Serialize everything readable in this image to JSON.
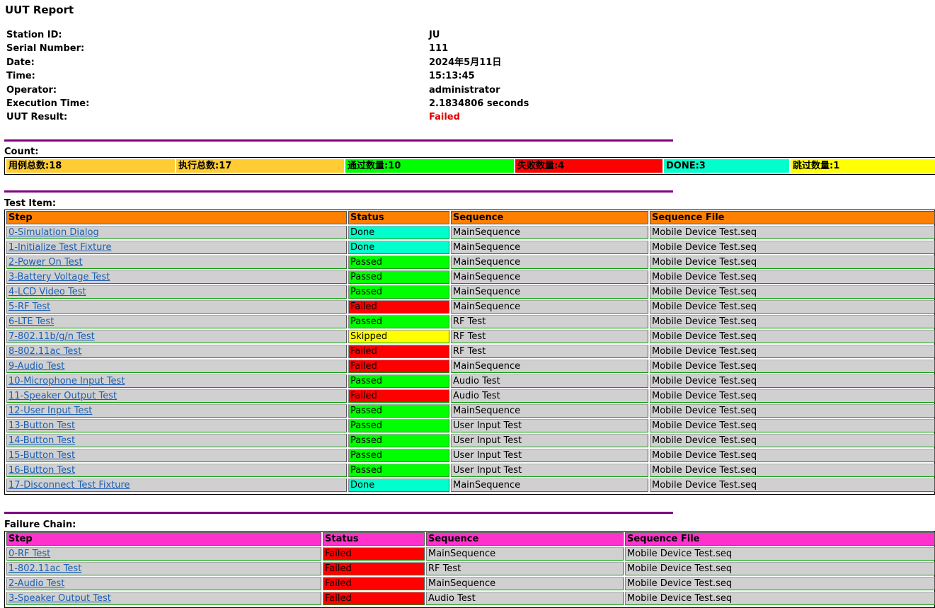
{
  "title": "UUT Report",
  "info": [
    {
      "label": "Station ID:",
      "value": "JU"
    },
    {
      "label": "Serial Number:",
      "value": "111"
    },
    {
      "label": "Date:",
      "value": "2024年5月11日"
    },
    {
      "label": "Time:",
      "value": "15:13:45"
    },
    {
      "label": "Operator:",
      "value": "administrator"
    },
    {
      "label": "Execution Time:",
      "value": "2.1834806 seconds"
    },
    {
      "label": "UUT Result:",
      "value": "Failed"
    }
  ],
  "count_label": "Count:",
  "counts": [
    {
      "text": "用例总数:18",
      "color": "#ffcc33"
    },
    {
      "text": "执行总数:17",
      "color": "#ffcc33"
    },
    {
      "text": "通过数量:10",
      "color": "#00ff00"
    },
    {
      "text": "失败数量:4",
      "color": "#ff0000"
    },
    {
      "text": "DONE:3",
      "color": "#00ffcc"
    },
    {
      "text": "跳过数量:1",
      "color": "#ffff00"
    }
  ],
  "test_item_label": "Test Item:",
  "failure_chain_label": "Failure Chain:",
  "columns": {
    "step": "Step",
    "status": "Status",
    "sequence": "Sequence",
    "file": "Sequence File"
  },
  "colors": {
    "test_header": "#ff8000",
    "failure_header": "#ff33cc",
    "divider": "#800080",
    "status": {
      "Done": "#00ffcc",
      "Passed": "#00ff00",
      "Failed": "#ff0000",
      "Skipped": "#ffff00"
    }
  },
  "test_items": [
    {
      "step": "0-Simulation Dialog",
      "status": "Done",
      "sequence": "MainSequence",
      "file": "Mobile Device Test.seq"
    },
    {
      "step": "1-Initialize Test Fixture",
      "status": "Done",
      "sequence": "MainSequence",
      "file": "Mobile Device Test.seq"
    },
    {
      "step": "2-Power On Test",
      "status": "Passed",
      "sequence": "MainSequence",
      "file": "Mobile Device Test.seq"
    },
    {
      "step": "3-Battery Voltage Test",
      "status": "Passed",
      "sequence": "MainSequence",
      "file": "Mobile Device Test.seq"
    },
    {
      "step": "4-LCD Video Test",
      "status": "Passed",
      "sequence": "MainSequence",
      "file": "Mobile Device Test.seq"
    },
    {
      "step": "5-RF Test",
      "status": "Failed",
      "sequence": "MainSequence",
      "file": "Mobile Device Test.seq"
    },
    {
      "step": "6-LTE Test",
      "status": "Passed",
      "sequence": "RF Test",
      "file": "Mobile Device Test.seq"
    },
    {
      "step": "7-802.11b/g/n Test",
      "status": "Skipped",
      "sequence": "RF Test",
      "file": "Mobile Device Test.seq"
    },
    {
      "step": "8-802.11ac Test",
      "status": "Failed",
      "sequence": "RF Test",
      "file": "Mobile Device Test.seq"
    },
    {
      "step": "9-Audio Test",
      "status": "Failed",
      "sequence": "MainSequence",
      "file": "Mobile Device Test.seq"
    },
    {
      "step": "10-Microphone Input Test",
      "status": "Passed",
      "sequence": "Audio Test",
      "file": "Mobile Device Test.seq"
    },
    {
      "step": "11-Speaker Output Test",
      "status": "Failed",
      "sequence": "Audio Test",
      "file": "Mobile Device Test.seq"
    },
    {
      "step": "12-User Input Test",
      "status": "Passed",
      "sequence": "MainSequence",
      "file": "Mobile Device Test.seq"
    },
    {
      "step": "13-Button Test",
      "status": "Passed",
      "sequence": "User Input Test",
      "file": "Mobile Device Test.seq"
    },
    {
      "step": "14-Button Test",
      "status": "Passed",
      "sequence": "User Input Test",
      "file": "Mobile Device Test.seq"
    },
    {
      "step": "15-Button Test",
      "status": "Passed",
      "sequence": "User Input Test",
      "file": "Mobile Device Test.seq"
    },
    {
      "step": "16-Button Test",
      "status": "Passed",
      "sequence": "User Input Test",
      "file": "Mobile Device Test.seq"
    },
    {
      "step": "17-Disconnect Test Fixture",
      "status": "Done",
      "sequence": "MainSequence",
      "file": "Mobile Device Test.seq"
    }
  ],
  "failure_chain": [
    {
      "step": "0-RF Test",
      "status": "Failed",
      "sequence": "MainSequence",
      "file": "Mobile Device Test.seq"
    },
    {
      "step": "1-802.11ac Test",
      "status": "Failed",
      "sequence": "RF Test",
      "file": "Mobile Device Test.seq"
    },
    {
      "step": "2-Audio Test",
      "status": "Failed",
      "sequence": "MainSequence",
      "file": "Mobile Device Test.seq"
    },
    {
      "step": "3-Speaker Output Test",
      "status": "Failed",
      "sequence": "Audio Test",
      "file": "Mobile Device Test.seq"
    }
  ]
}
